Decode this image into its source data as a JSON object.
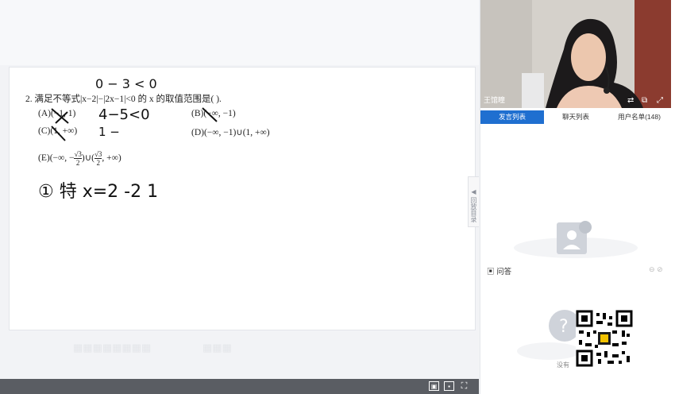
{
  "question": {
    "line1": "2. 满足不等式|x−2|−|2x−1|<0 的 x 的取值范围是(        ).",
    "optA": "(A)(−1, 1)",
    "optB": "(B)(−∞, −1)",
    "optC": "(C)(1, +∞)",
    "optD": "(D)(−∞, −1)∪(1, +∞)",
    "optE_prefix": "(E)",
    "optE_a": "(−∞, −",
    "optE_b": ")∪(",
    "optE_c": ", +∞)",
    "sqrt3": "√3",
    "two": "2"
  },
  "handwriting": {
    "top": "0 − 3 < 0",
    "mid": "4−5<0",
    "dash": "1 −",
    "bottom": "① 特   x=2   -2   1"
  },
  "catalog_tab": "回放目录",
  "video": {
    "teacher": "王馆瞳"
  },
  "tabs": [
    "发言列表",
    "聊天列表",
    "用户名单(148)"
  ],
  "qa": {
    "title": "问答",
    "empty": "没有"
  },
  "colors": {
    "accent": "#1f6fd0",
    "bar": "#5a5d63"
  }
}
